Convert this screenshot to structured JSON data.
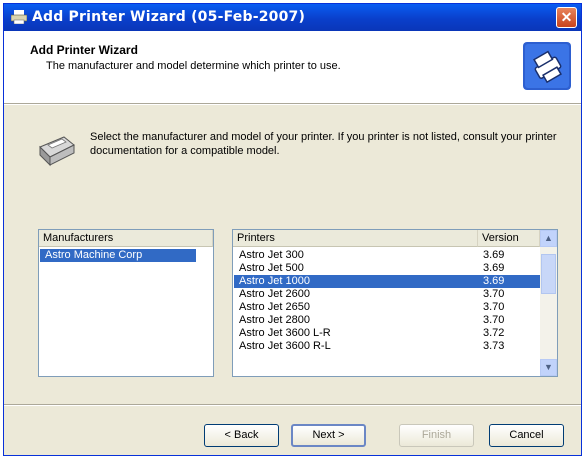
{
  "window": {
    "title": "Add Printer Wizard (05-Feb-2007)",
    "close_glyph": "✕"
  },
  "header": {
    "title": "Add Printer Wizard",
    "subtitle": "The manufacturer and model determine which printer to use.",
    "icon": "printer-wizard-icon"
  },
  "intro": {
    "text": "Select the manufacturer and model of your printer. If you printer is not listed, consult your printer documentation for a compatible model.",
    "icon": "printer-icon"
  },
  "manufacturers": {
    "header": "Manufacturers",
    "items": [
      "Astro Machine Corp"
    ],
    "selected_index": 0
  },
  "printers": {
    "header_name": "Printers",
    "header_version": "Version",
    "rows": [
      {
        "name": "Astro Jet 300",
        "version": "3.69"
      },
      {
        "name": "Astro Jet 500",
        "version": "3.69"
      },
      {
        "name": "Astro Jet 1000",
        "version": "3.69"
      },
      {
        "name": "Astro Jet 2600",
        "version": "3.70"
      },
      {
        "name": "Astro Jet 2650",
        "version": "3.70"
      },
      {
        "name": "Astro Jet 2800",
        "version": "3.70"
      },
      {
        "name": "Astro Jet 3600 L-R",
        "version": "3.72"
      },
      {
        "name": "Astro Jet 3600 R-L",
        "version": "3.73"
      }
    ],
    "selected_index": 2
  },
  "buttons": {
    "back": "< Back",
    "next": "Next >",
    "finish": "Finish",
    "cancel": "Cancel"
  },
  "colors": {
    "selection": "#316ac5",
    "titlebar": "#0a4fe0"
  }
}
